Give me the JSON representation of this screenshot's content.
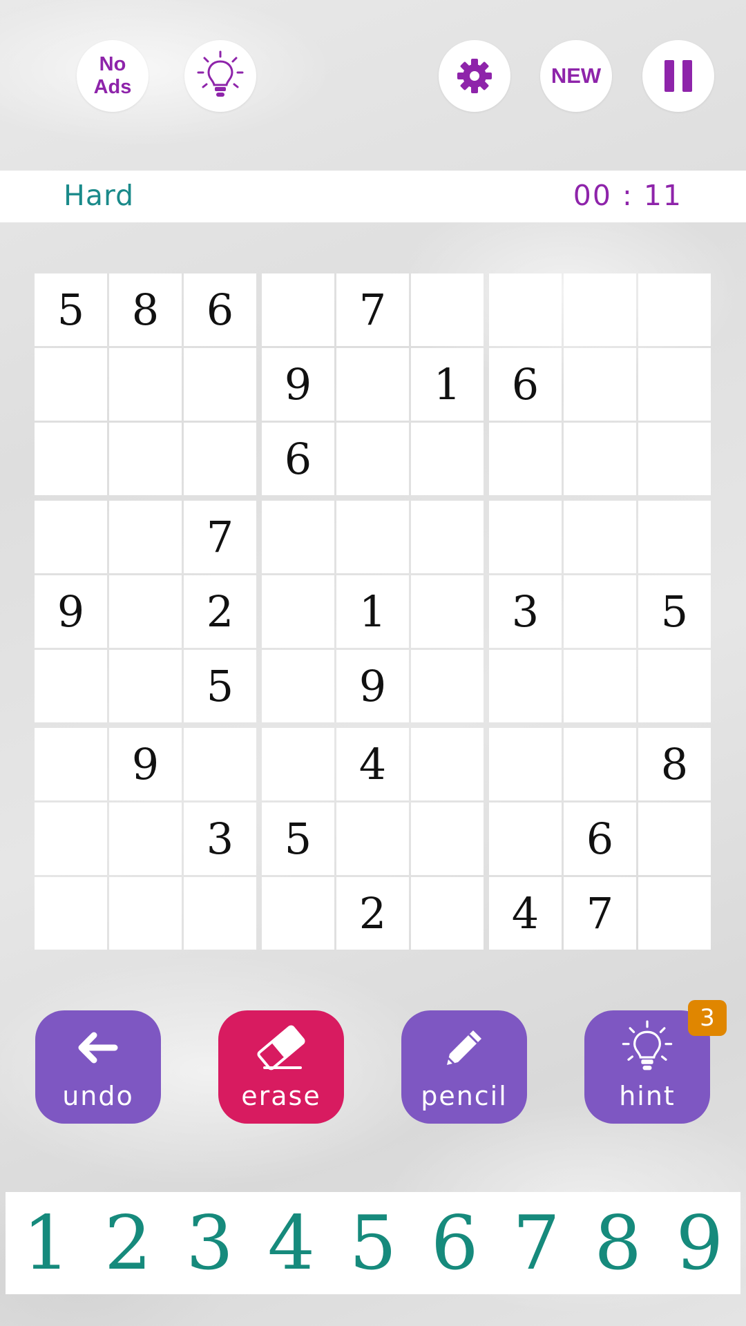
{
  "top_bar": {
    "no_ads_line1": "No",
    "no_ads_line2": "Ads",
    "idea_icon": "lightbulb-icon",
    "settings_icon": "gear-icon",
    "new_label": "NEW",
    "pause_icon": "pause-icon"
  },
  "status": {
    "difficulty": "Hard",
    "timer": "00 : 11"
  },
  "board": {
    "rows": [
      [
        "5",
        "8",
        "6",
        "",
        "7",
        "",
        "",
        "",
        ""
      ],
      [
        "",
        "",
        "",
        "9",
        "",
        "1",
        "6",
        "",
        ""
      ],
      [
        "",
        "",
        "",
        "6",
        "",
        "",
        "",
        "",
        ""
      ],
      [
        "",
        "",
        "7",
        "",
        "",
        "",
        "",
        "",
        ""
      ],
      [
        "9",
        "",
        "2",
        "",
        "1",
        "",
        "3",
        "",
        "5"
      ],
      [
        "",
        "",
        "5",
        "",
        "9",
        "",
        "",
        "",
        ""
      ],
      [
        "",
        "9",
        "",
        "",
        "4",
        "",
        "",
        "",
        "8"
      ],
      [
        "",
        "",
        "3",
        "5",
        "",
        "",
        "",
        "6",
        ""
      ],
      [
        "",
        "",
        "",
        "",
        "2",
        "",
        "4",
        "7",
        ""
      ]
    ]
  },
  "actions": {
    "undo": "undo",
    "erase": "erase",
    "pencil": "pencil",
    "hint": "hint",
    "hint_count": "3"
  },
  "numpad": [
    "1",
    "2",
    "3",
    "4",
    "5",
    "6",
    "7",
    "8",
    "9"
  ],
  "colors": {
    "purple": "#8e24aa",
    "button_purple": "#7e57c2",
    "erase_pink": "#d81b60",
    "teal": "#168a7c",
    "badge_orange": "#e08600"
  }
}
